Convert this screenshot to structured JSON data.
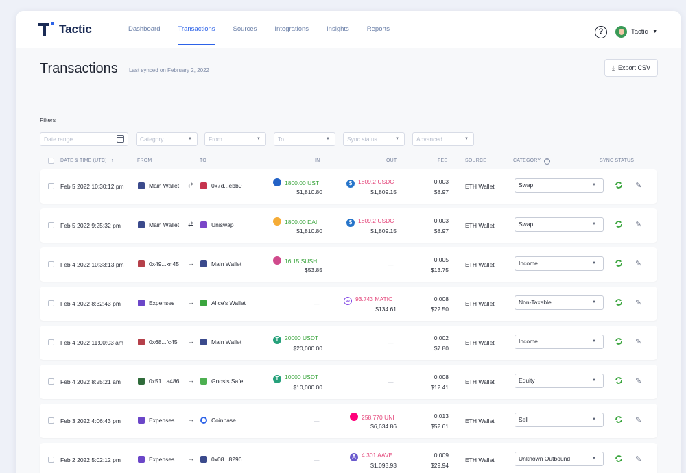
{
  "app": {
    "brand": "Tactic"
  },
  "nav": [
    "Dashboard",
    "Transactions",
    "Sources",
    "Integrations",
    "Insights",
    "Reports"
  ],
  "nav_active": "Transactions",
  "user": {
    "name": "Tactic"
  },
  "page": {
    "title": "Transactions",
    "synced": "Last synced on February 2, 2022",
    "export_label": "Export CSV"
  },
  "filters": {
    "label": "Filters",
    "date_range": "Date range",
    "category": "Category",
    "from": "From",
    "to": "To",
    "sync_status": "Sync status",
    "advanced": "Advanced"
  },
  "columns": {
    "date": "DATE & TIME (UTC)",
    "from": "FROM",
    "to": "TO",
    "in": "IN",
    "out": "OUT",
    "fee": "FEE",
    "source": "SOURCE",
    "category": "CATEGORY",
    "sync": "SYNC STATUS"
  },
  "rows": [
    {
      "date": "Feb 5 2022 10:30:12 pm",
      "from": "Main Wallet",
      "to": "0x7d...ebb0",
      "in_amt": "1800.00 UST",
      "in_usd": "$1,810.80",
      "out_amt": "1809.2 USDC",
      "out_usd": "$1,809.15",
      "fee": "0.003",
      "fee_usd": "$8.97",
      "source": "ETH Wallet",
      "category": "Swap"
    },
    {
      "date": "Feb 5 2022 9:25:32 pm",
      "from": "Main Wallet",
      "to": "Uniswap",
      "in_amt": "1800.00 DAI",
      "in_usd": "$1,810.80",
      "out_amt": "1809.2 USDC",
      "out_usd": "$1,809.15",
      "fee": "0.003",
      "fee_usd": "$8.97",
      "source": "ETH Wallet",
      "category": "Swap"
    },
    {
      "date": "Feb 4 2022 10:33:13 pm",
      "from": "0x49...kn45",
      "to": "Main Wallet",
      "in_amt": "16.15 SUSHI",
      "in_usd": "$53.85",
      "out_amt": "",
      "out_usd": "",
      "fee": "0.005",
      "fee_usd": "$13.75",
      "source": "ETH Wallet",
      "category": "Income"
    },
    {
      "date": "Feb 4 2022 8:32:43 pm",
      "from": "Expenses",
      "to": "Alice's Wallet",
      "in_amt": "",
      "in_usd": "",
      "out_amt": "93.743 MATIC",
      "out_usd": "$134.61",
      "fee": "0.008",
      "fee_usd": "$22.50",
      "source": "ETH Wallet",
      "category": "Non-Taxable"
    },
    {
      "date": "Feb 4 2022 11:00:03 am",
      "from": "0x68...fc45",
      "to": "Main Wallet",
      "in_amt": "20000 USDT",
      "in_usd": "$20,000.00",
      "out_amt": "",
      "out_usd": "",
      "fee": "0.002",
      "fee_usd": "$7.80",
      "source": "ETH Wallet",
      "category": "Income"
    },
    {
      "date": "Feb 4 2022 8:25:21 am",
      "from": "0x51...a486",
      "to": "Gnosis Safe",
      "in_amt": "10000 USDT",
      "in_usd": "$10,000.00",
      "out_amt": "",
      "out_usd": "",
      "fee": "0.008",
      "fee_usd": "$12.41",
      "source": "ETH Wallet",
      "category": "Equity"
    },
    {
      "date": "Feb 3 2022 4:06:43 pm",
      "from": "Expenses",
      "to": "Coinbase",
      "in_amt": "",
      "in_usd": "",
      "out_amt": "258.770 UNI",
      "out_usd": "$6,634.86",
      "fee": "0.013",
      "fee_usd": "$52.61",
      "source": "ETH Wallet",
      "category": "Sell"
    },
    {
      "date": "Feb 2 2022 5:02:12 pm",
      "from": "Expenses",
      "to": "0x08...8296",
      "in_amt": "",
      "in_usd": "",
      "out_amt": "4.301 AAVE",
      "out_usd": "$1,093.93",
      "fee": "0.009",
      "fee_usd": "$29.94",
      "source": "ETH Wallet",
      "category": "Unknown Outbound"
    }
  ]
}
